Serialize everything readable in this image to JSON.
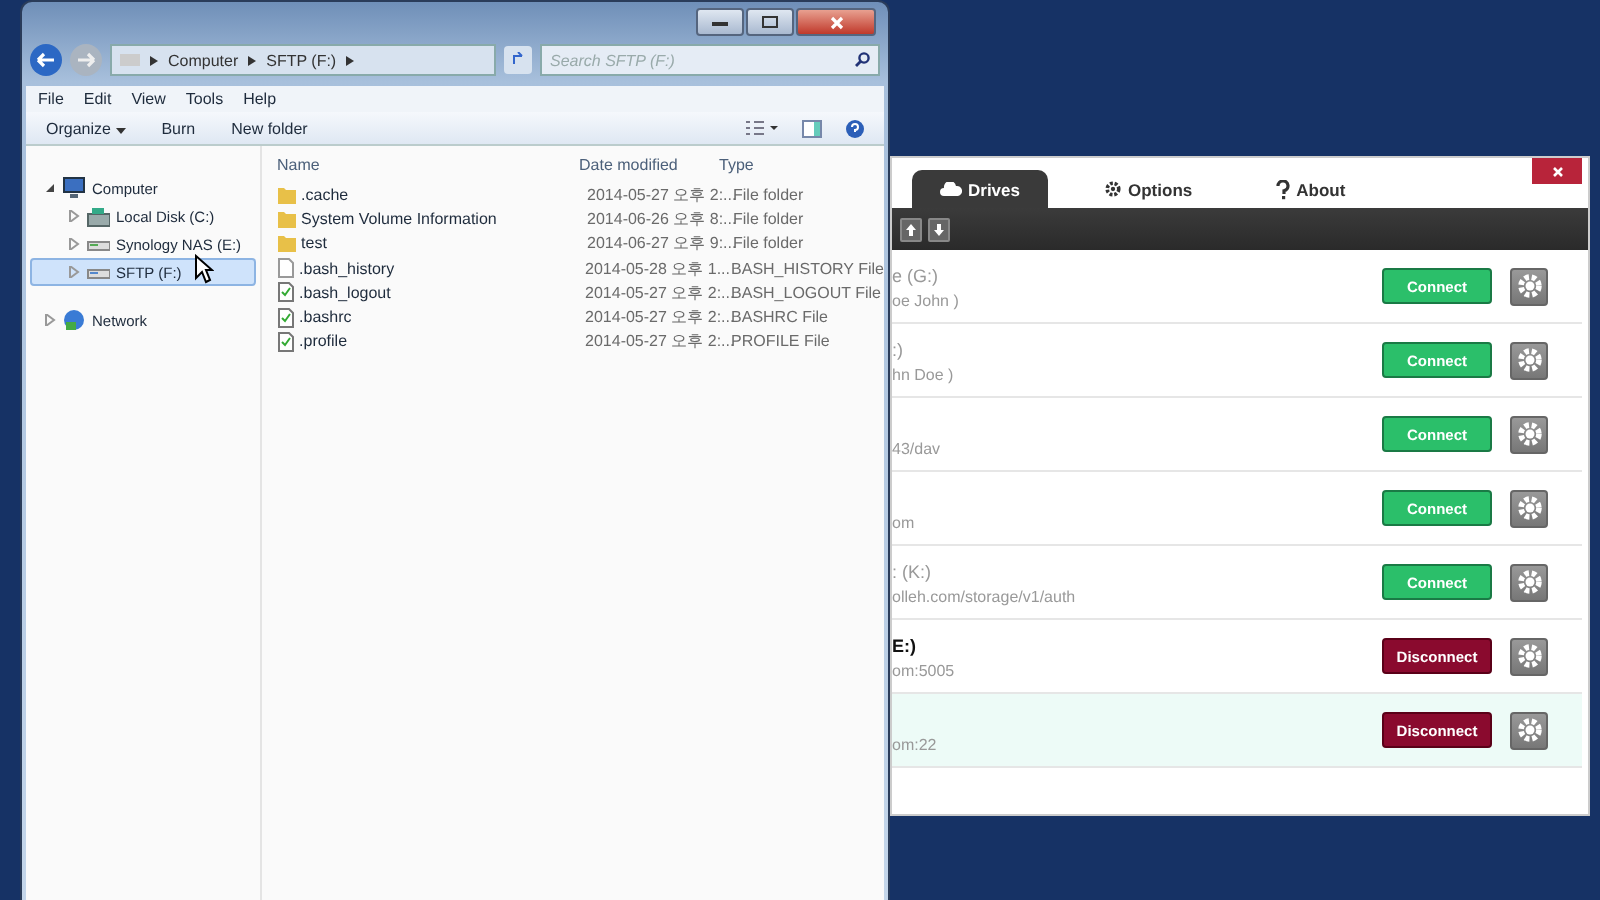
{
  "explorer": {
    "address": [
      "Computer",
      "SFTP (F:)"
    ],
    "search": {
      "placeholder": "Search SFTP (F:)"
    },
    "menu": [
      "File",
      "Edit",
      "View",
      "Tools",
      "Help"
    ],
    "toolbar": [
      "Organize",
      "Burn",
      "New folder"
    ],
    "nav": [
      {
        "label": "Computer",
        "kind": "computer",
        "expanded": true,
        "children": [
          {
            "label": "Local Disk (C:)",
            "kind": "disk",
            "selected": false
          },
          {
            "label": "Synology NAS (E:)",
            "kind": "nas",
            "selected": false
          },
          {
            "label": "SFTP (F:)",
            "kind": "sftp",
            "selected": true
          }
        ]
      },
      {
        "label": "Network",
        "kind": "network",
        "expanded": false
      }
    ],
    "columns": [
      "Name",
      "Date modified",
      "Type"
    ],
    "files": [
      {
        "name": ".cache",
        "date": "2014-05-27 오후 2:...",
        "type": "File folder",
        "kind": "folder"
      },
      {
        "name": "System Volume Information",
        "date": "2014-06-26 오후 8:...",
        "type": "File folder",
        "kind": "folder"
      },
      {
        "name": "test",
        "date": "2014-06-27 오후 9:...",
        "type": "File folder",
        "kind": "folder"
      },
      {
        "name": ".bash_history",
        "date": "2014-05-28 오후 1...",
        "type": "BASH_HISTORY File",
        "kind": "file"
      },
      {
        "name": ".bash_logout",
        "date": "2014-05-27 오후 2:...",
        "type": "BASH_LOGOUT File",
        "kind": "script"
      },
      {
        "name": ".bashrc",
        "date": "2014-05-27 오후 2:...",
        "type": "BASHRC File",
        "kind": "script"
      },
      {
        "name": ".profile",
        "date": "2014-05-27 오후 2:...",
        "type": "PROFILE File",
        "kind": "script"
      }
    ]
  },
  "app": {
    "tabs": [
      {
        "label": "Drives",
        "kind": "cloud",
        "selected": true
      },
      {
        "label": "Options",
        "kind": "gear",
        "selected": false
      },
      {
        "label": "About",
        "kind": "help",
        "selected": false
      }
    ],
    "drives": [
      {
        "name": "e (G:)",
        "detail": "oe John )",
        "connected": false,
        "selected": false,
        "button": "Connect"
      },
      {
        "name": ":)",
        "detail": "hn Doe )",
        "connected": false,
        "selected": false,
        "button": "Connect"
      },
      {
        "detail": "43/dav",
        "connected": false,
        "selected": false,
        "button": "Connect"
      },
      {
        "detail": "om",
        "connected": false,
        "selected": false,
        "button": "Connect"
      },
      {
        "name": ": (K:)",
        "detail": "olleh.com/storage/v1/auth",
        "connected": false,
        "selected": false,
        "button": "Connect"
      },
      {
        "name": "E:)",
        "detail": "om:5005",
        "connected": true,
        "selected": false,
        "button": "Disconnect"
      },
      {
        "detail": "om:22",
        "connected": true,
        "selected": true,
        "button": "Disconnect"
      }
    ]
  }
}
